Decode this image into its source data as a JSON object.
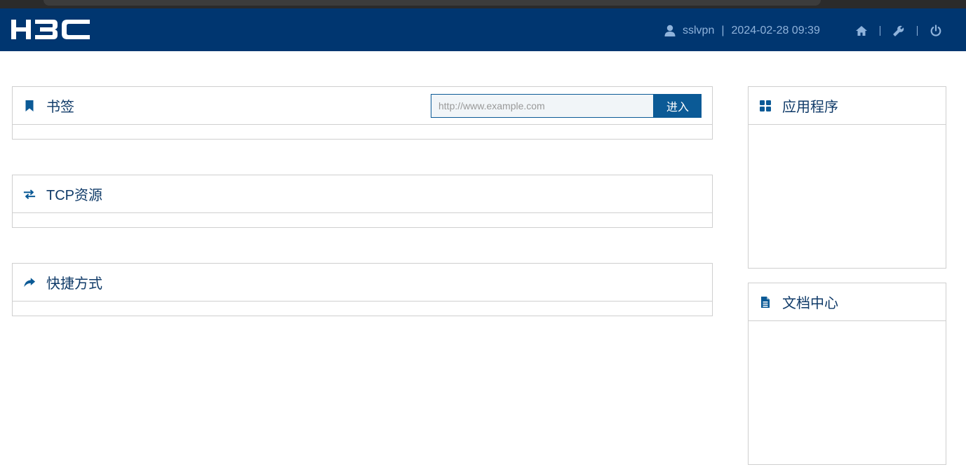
{
  "header": {
    "logo_text": "H3C",
    "username": "sslvpn",
    "separator": "|",
    "datetime": "2024-02-28 09:39",
    "icons": [
      "user-icon",
      "home-icon",
      "wrench-icon",
      "power-icon"
    ],
    "colors": {
      "bar": "#003670",
      "text": "#8fb3db"
    }
  },
  "bookmarks": {
    "title": "书签",
    "icon": "bookmark-icon",
    "url_placeholder": "http://www.example.com",
    "url_value": "",
    "go_label": "进入"
  },
  "tcp": {
    "title": "TCP资源",
    "icon": "exchange-icon"
  },
  "shortcuts": {
    "title": "快捷方式",
    "icon": "share-icon"
  },
  "apps": {
    "title": "应用程序",
    "icon": "grid-icon"
  },
  "docs": {
    "title": "文档中心",
    "icon": "document-icon"
  },
  "theme": {
    "accent": "#0b5a96",
    "title_color": "#0f3a68",
    "border": "#cfcfcf"
  }
}
